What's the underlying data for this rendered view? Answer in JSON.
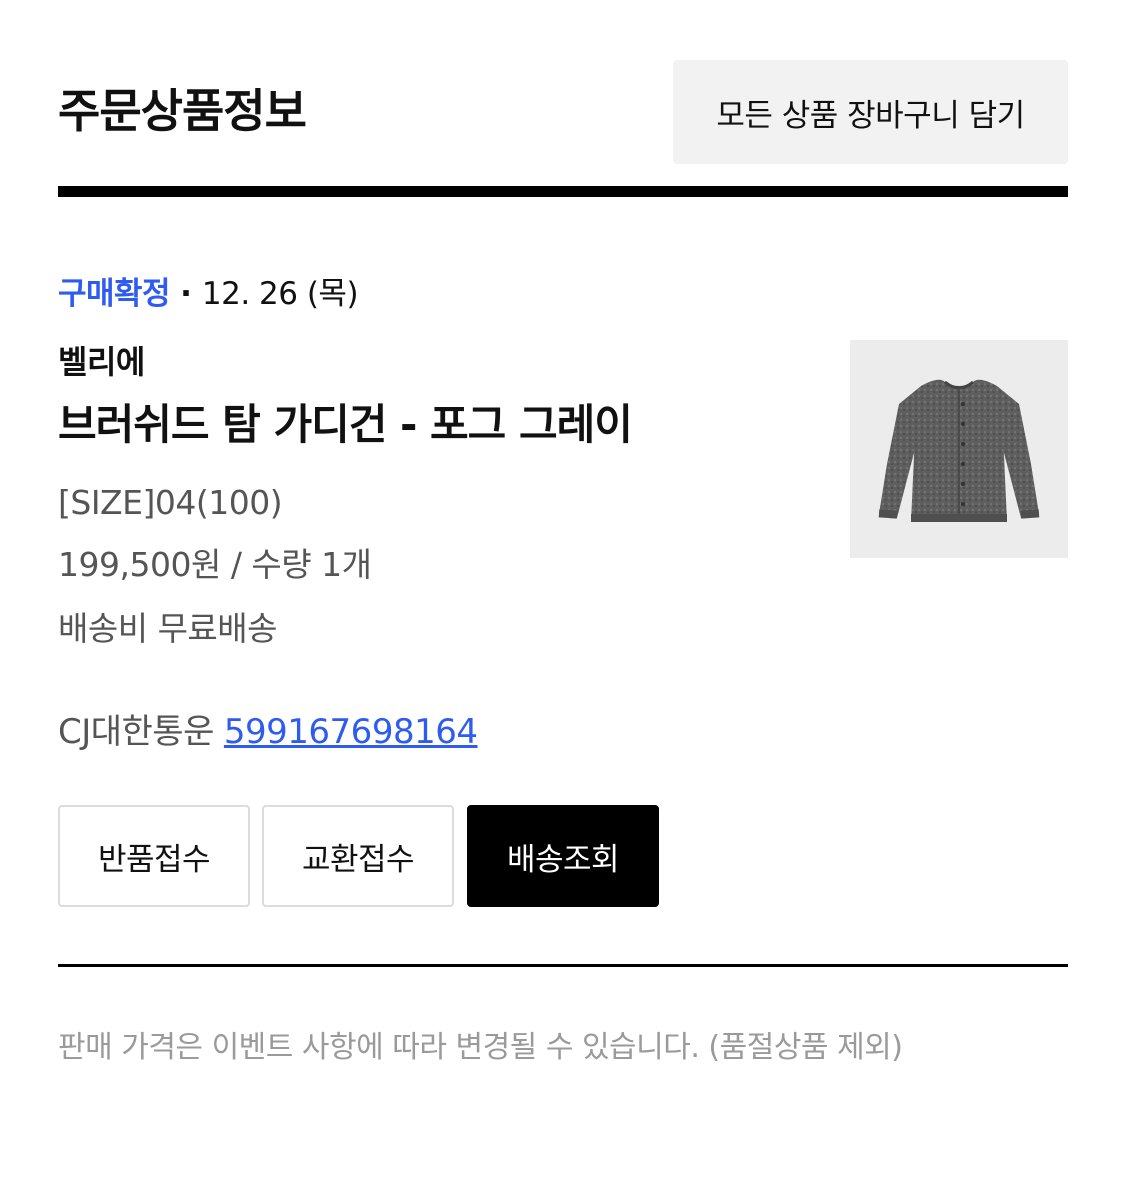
{
  "header": {
    "title": "주문상품정보",
    "cart_all_label": "모든 상품 장바구니 담기"
  },
  "order": {
    "status": "구매확정",
    "separator": "·",
    "date": "12. 26 (목)",
    "brand": "벨리에",
    "product_name": "브러쉬드 탐 가디건 - 포그 그레이",
    "option": "[SIZE]04(100)",
    "price_quantity": "199,500원 / 수량 1개",
    "shipping": "배송비 무료배송",
    "courier": "CJ대한통운",
    "tracking_number": "599167698164",
    "product_image_icon": "gray-cardigan-image"
  },
  "actions": {
    "return_label": "반품접수",
    "exchange_label": "교환접수",
    "track_label": "배송조회"
  },
  "footer": {
    "notice": "판매 가격은 이벤트 사항에 따라 변경될 수 있습니다. (품절상품 제외)"
  },
  "colors": {
    "accent_blue": "#2f5cf0",
    "text_primary": "#111111",
    "text_secondary": "#555555",
    "text_muted": "#9a9a9a",
    "button_gray": "#f2f2f2",
    "dark": "#000000"
  }
}
